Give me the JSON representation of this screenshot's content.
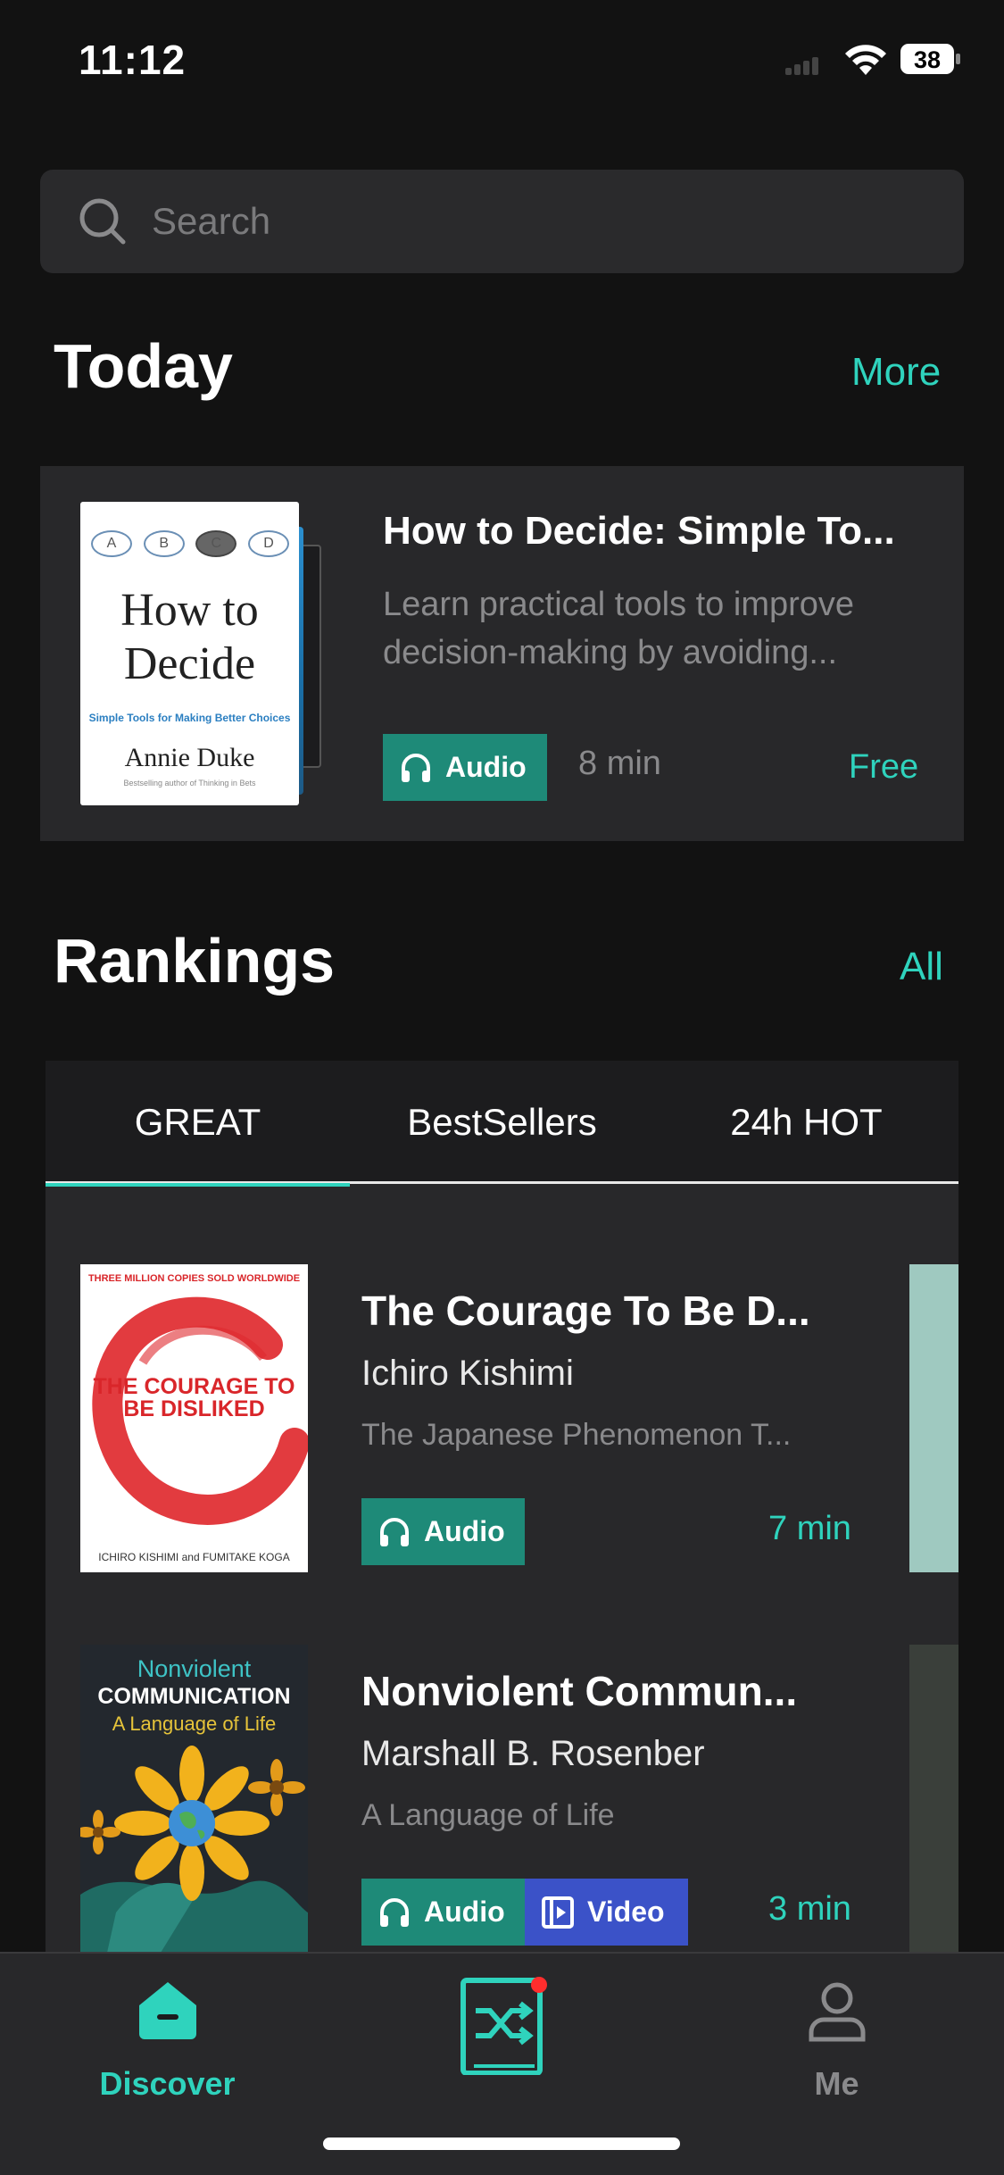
{
  "status_bar": {
    "time": "11:12",
    "battery": "38"
  },
  "search": {
    "placeholder": "Search"
  },
  "today": {
    "heading": "Today",
    "more_label": "More",
    "book": {
      "title": "How to Decide: Simple To...",
      "description": "Learn practical tools to improve decision-making by avoiding...",
      "badge": "Audio",
      "duration": "8 min",
      "price": "Free",
      "cover": {
        "circles": [
          "A",
          "B",
          "C",
          "D"
        ],
        "title_line1": "How to",
        "title_line2": "Decide",
        "subtitle": "Simple Tools for Making Better Choices",
        "author": "Annie Duke",
        "tagline": "Bestselling author of Thinking in Bets"
      }
    }
  },
  "rankings": {
    "heading": "Rankings",
    "all_label": "All",
    "tabs": [
      {
        "label": "GREAT",
        "active": true
      },
      {
        "label": "BestSellers",
        "active": false
      },
      {
        "label": "24h HOT",
        "active": false
      }
    ],
    "items": [
      {
        "title": "The Courage To Be D...",
        "author": "Ichiro Kishimi",
        "description": "The Japanese Phenomenon T...",
        "badges": [
          "Audio"
        ],
        "duration": "7 min",
        "cover": {
          "top": "THREE MILLION COPIES SOLD WORLDWIDE",
          "title": "THE COURAGE TO BE DISLIKED",
          "bottom": "ICHIRO KISHIMI and FUMITAKE KOGA"
        }
      },
      {
        "title": "Nonviolent Commun...",
        "author": "Marshall B. Rosenber",
        "description": "A Language of Life",
        "badges": [
          "Audio",
          "Video"
        ],
        "duration": "3 min",
        "cover": {
          "line1": "Nonviolent",
          "line2": "COMMUNICATION",
          "line3": "A Language of Life"
        }
      }
    ]
  },
  "bottom_nav": {
    "items": [
      {
        "label": "Discover",
        "active": true
      },
      {
        "label": "",
        "active": false
      },
      {
        "label": "Me",
        "active": false
      }
    ]
  },
  "colors": {
    "accent": "#2fd3bd",
    "audio_badge": "#1e8a78",
    "video_badge": "#3b52c8",
    "background": "#121212",
    "card": "#28282a"
  }
}
